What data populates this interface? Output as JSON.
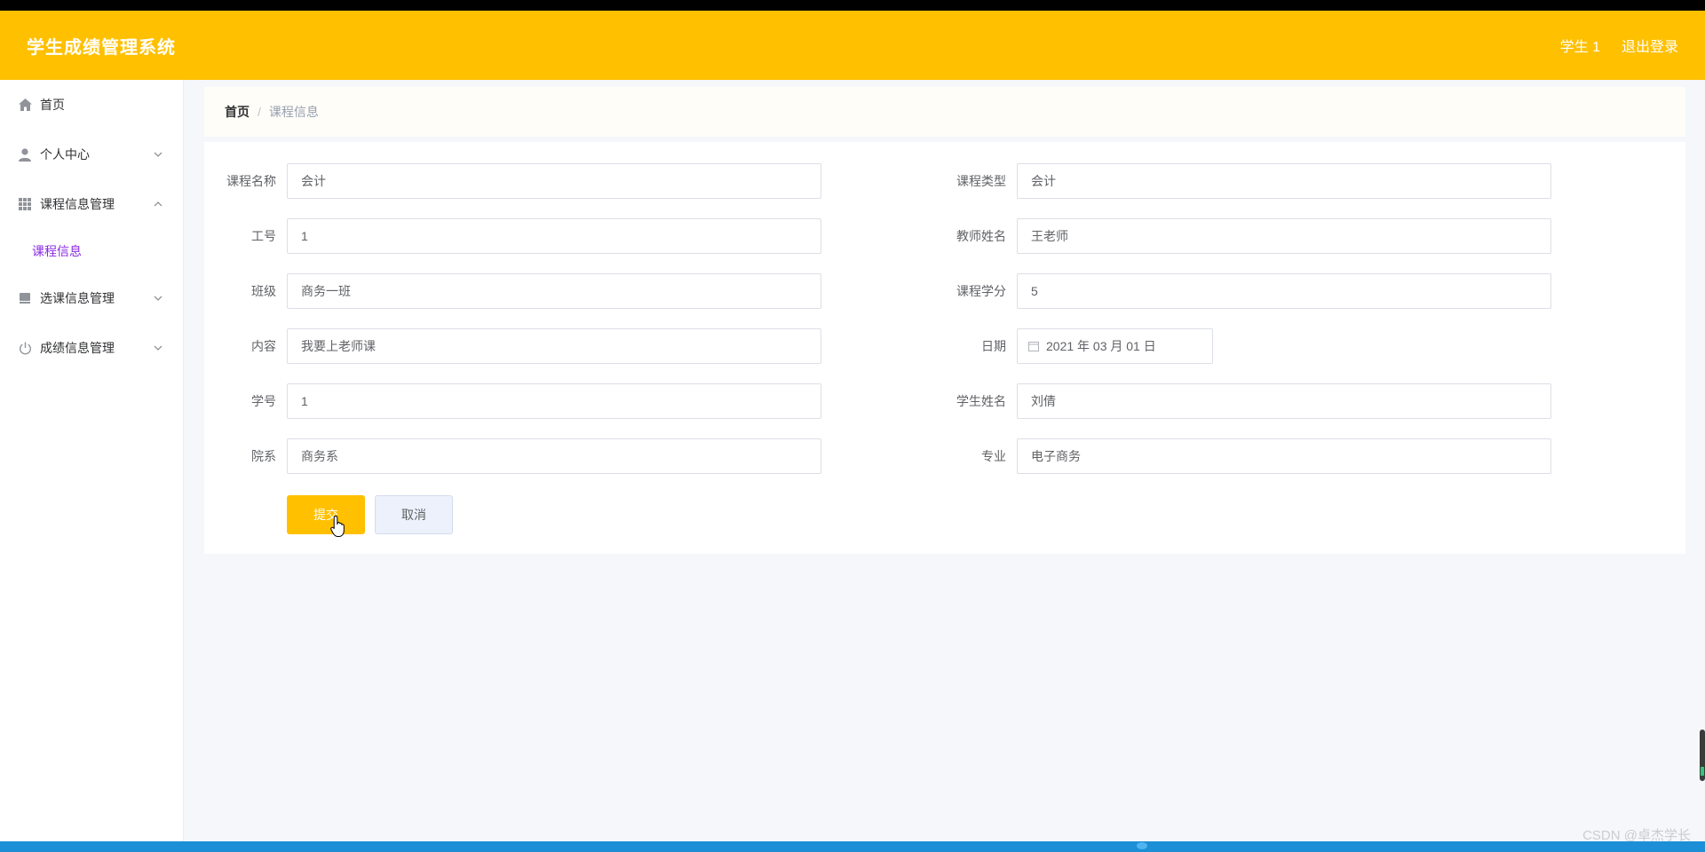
{
  "header": {
    "app_title": "学生成绩管理系统",
    "user": "学生 1",
    "logout": "退出登录"
  },
  "sidebar": {
    "items": [
      {
        "label": "首页",
        "icon": "home-icon"
      },
      {
        "label": "个人中心",
        "icon": "user-icon"
      },
      {
        "label": "课程信息管理",
        "icon": "grid-icon"
      },
      {
        "label": "选课信息管理",
        "icon": "book-icon"
      },
      {
        "label": "成绩信息管理",
        "icon": "power-icon"
      }
    ],
    "submenu": {
      "label": "课程信息"
    }
  },
  "breadcrumb": {
    "home": "首页",
    "separator": "/",
    "current": "课程信息"
  },
  "form": {
    "course_name": {
      "label": "课程名称",
      "value": "会计"
    },
    "course_type": {
      "label": "课程类型",
      "value": "会计"
    },
    "teacher_id": {
      "label": "工号",
      "value": "1"
    },
    "teacher_name": {
      "label": "教师姓名",
      "value": "王老师"
    },
    "class": {
      "label": "班级",
      "value": "商务一班"
    },
    "credit": {
      "label": "课程学分",
      "value": "5"
    },
    "content": {
      "label": "内容",
      "value": "我要上老师课"
    },
    "date": {
      "label": "日期",
      "value": "2021 年 03 月 01 日"
    },
    "student_id": {
      "label": "学号",
      "value": "1"
    },
    "student_name": {
      "label": "学生姓名",
      "value": "刘倩"
    },
    "department": {
      "label": "院系",
      "value": "商务系"
    },
    "major": {
      "label": "专业",
      "value": "电子商务"
    },
    "submit": "提交",
    "cancel": "取消"
  },
  "watermark": "CSDN @卓杰学长",
  "colors": {
    "accent": "#ffc000",
    "submenu_active": "#8a2be2",
    "background": "#f5f7fa"
  }
}
